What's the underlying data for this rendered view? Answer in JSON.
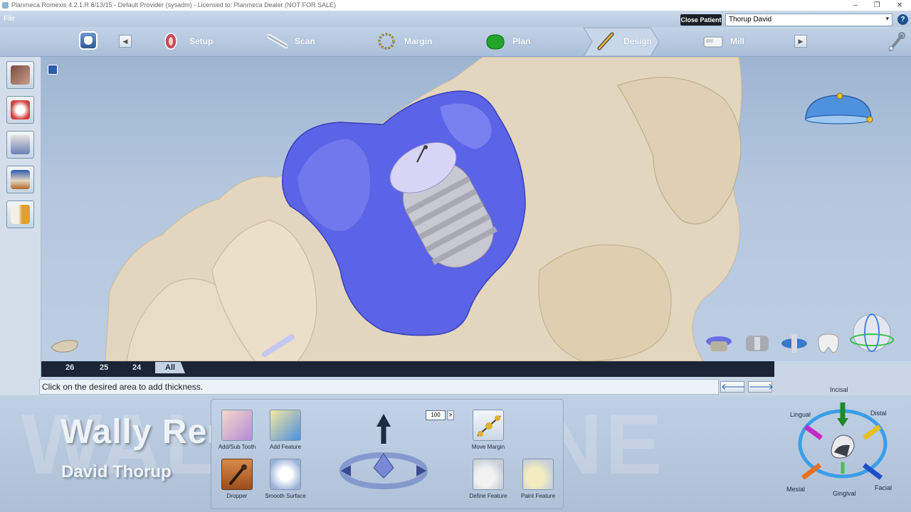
{
  "titlebar": {
    "title": "Planmeca Romexis 4.2.1.R  8/13/15 - Default Provider (sysadm) - Licensed to: Planmeca Dealer (NOT FOR SALE)",
    "minimize": "‒",
    "maximize": "❐",
    "close": "✕"
  },
  "menubar": {
    "file": "File",
    "close_patient": "Close Patient",
    "patient_name": "Thorup  David",
    "help": "?"
  },
  "workflow": {
    "prev": "◀",
    "next": "▶",
    "steps": [
      {
        "label": "Setup"
      },
      {
        "label": "Scan"
      },
      {
        "label": "Margin"
      },
      {
        "label": "Plan"
      },
      {
        "label": "Design"
      },
      {
        "label": "Mill"
      }
    ],
    "active_step": "Design"
  },
  "tooth_tabs": [
    "26",
    "25",
    "24",
    "All"
  ],
  "status": {
    "message": "Click on the desired area to add thickness.",
    "back": "🡐",
    "forward": "🡒"
  },
  "overlay": {
    "watermark": "WALLY RENNE",
    "presenter_name": "Wally Renne",
    "presenter_sub": "David Thorup"
  },
  "tools": {
    "add_tooth_label": "Add/Sub Tooth",
    "add_feature_label": "Add Feature",
    "dropper_label": "Dropper",
    "smooth_surface_label": "Smooth Surface",
    "move_margin_label": "Move Margin",
    "define_feature_label": "Define Feature",
    "paint_feature_label": "Paint Feature",
    "thickness_value": "100",
    "thickness_caret": ">"
  },
  "orientation": {
    "incisal": "Incisal",
    "lingual": "Lingual",
    "distal": "Distal",
    "mesial": "Mesial",
    "gingival": "Gingival",
    "facial": "Facial"
  },
  "colors": {
    "restoration": "#5b63e6",
    "tissue": "#e3d6be",
    "accent": "#2d5fb5"
  }
}
